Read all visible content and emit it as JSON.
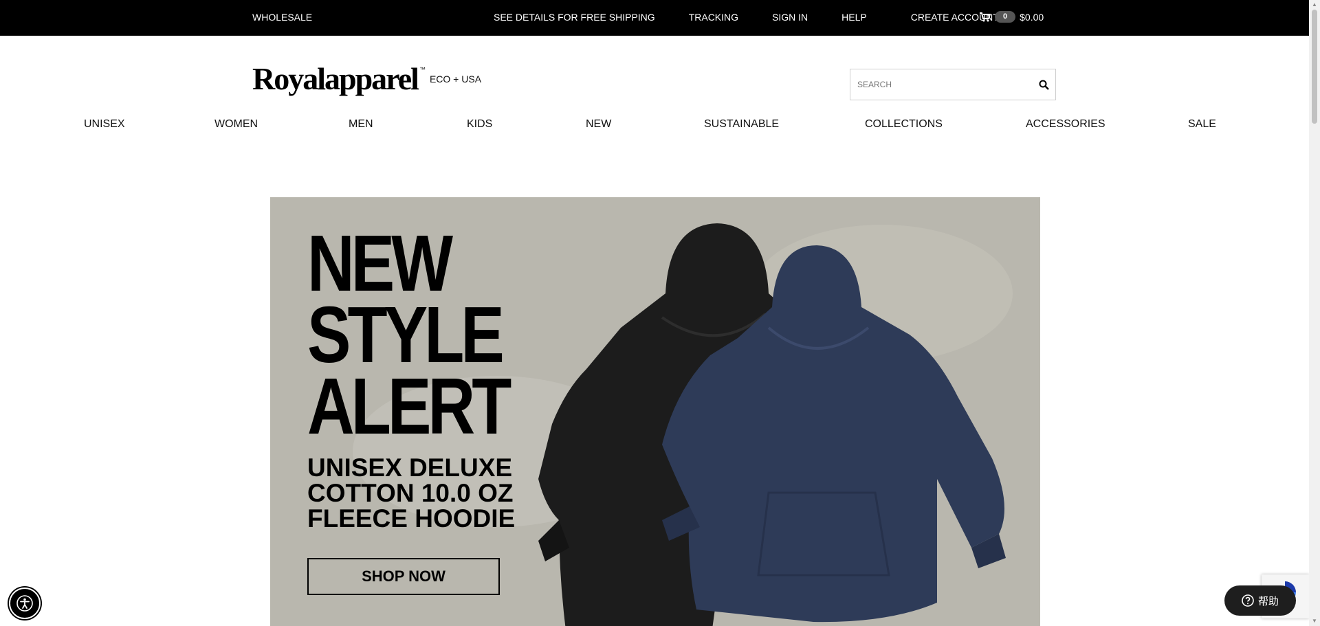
{
  "topbar": {
    "wholesale": "WHOLESALE",
    "free_shipping": "SEE DETAILS FOR FREE SHIPPING",
    "tracking": "TRACKING",
    "sign_in": "SIGN IN",
    "help": "HELP",
    "create_account": "CREATE ACCOUNT",
    "cart_count": "0",
    "cart_total": "$0.00"
  },
  "logo": {
    "brand": "Royalapparel",
    "tm": "™",
    "tagline": "ECO + USA"
  },
  "search": {
    "placeholder": "SEARCH"
  },
  "nav": [
    "UNISEX",
    "WOMEN",
    "MEN",
    "KIDS",
    "NEW",
    "SUSTAINABLE",
    "COLLECTIONS",
    "ACCESSORIES",
    "SALE"
  ],
  "hero": {
    "headline_1": "NEW",
    "headline_2": "STYLE",
    "headline_3": "ALERT",
    "sub_1": "UNISEX DELUXE",
    "sub_2": "COTTON 10.0 OZ",
    "sub_3": "FLEECE HOODIE",
    "cta": "SHOP NOW",
    "colors": {
      "background": "#b9b7ae",
      "black_hoodie": "#1c1c1c",
      "navy_hoodie": "#2e3b58"
    }
  },
  "widgets": {
    "help_label": "帮助"
  }
}
